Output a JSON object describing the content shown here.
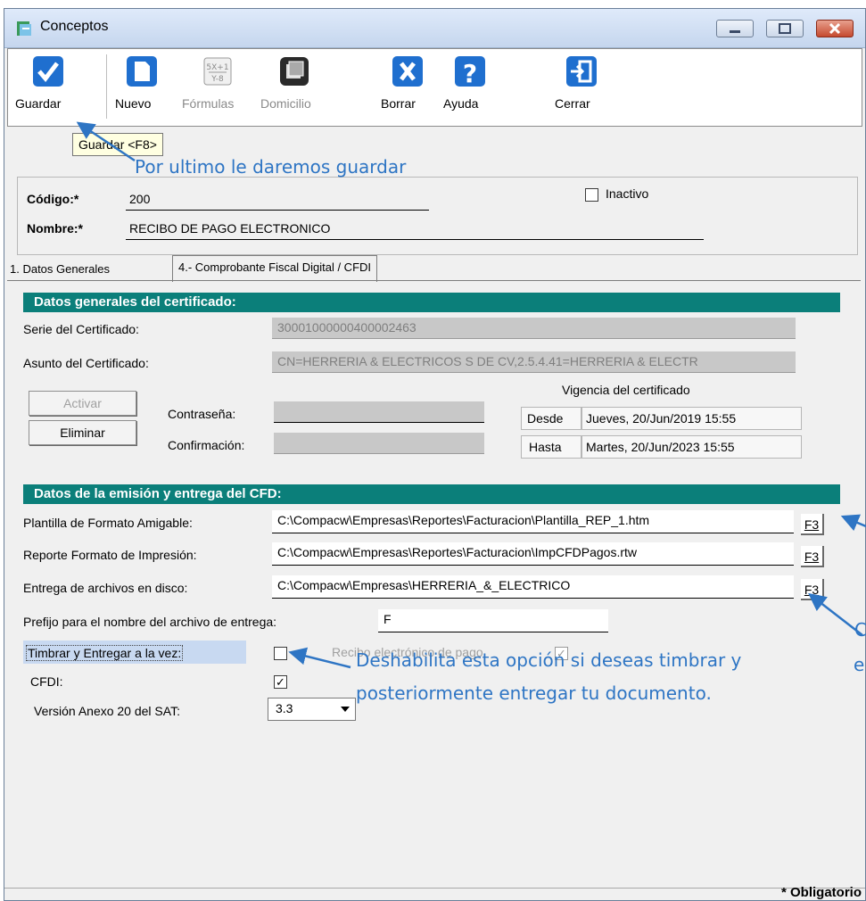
{
  "window": {
    "title": "Conceptos"
  },
  "toolbar": {
    "buttons": [
      {
        "label": "Guardar",
        "icon": "checkmark-icon"
      },
      {
        "label": "Nuevo",
        "icon": "new-document-icon"
      },
      {
        "label": "Fórmulas",
        "icon": "formula-icon"
      },
      {
        "label": "Domicilio",
        "icon": "address-icon"
      },
      {
        "label": "Borrar",
        "icon": "delete-icon"
      },
      {
        "label": "Ayuda",
        "icon": "help-icon"
      },
      {
        "label": "Cerrar",
        "icon": "exit-icon"
      }
    ]
  },
  "tooltip": "Guardar <F8>",
  "annotations": {
    "save_note": "Por ultimo le daremos guardar",
    "timbrar_note_line1": "Deshabilita esta opción si deseas timbrar y",
    "timbrar_note_line2": "posteriormente entregar tu documento.",
    "cut_text_1": "C",
    "cut_text_2": "e"
  },
  "header": {
    "codigo_label": "Código:*",
    "codigo_value": "200",
    "nombre_label": "Nombre:*",
    "nombre_value": "RECIBO DE PAGO ELECTRONICO",
    "inactivo_label": "Inactivo"
  },
  "tabs": [
    {
      "label": "1. Datos Generales"
    },
    {
      "label": "4.- Comprobante Fiscal Digital / CFDI"
    }
  ],
  "cert": {
    "section_title": "Datos generales del certificado:",
    "serie_label": "Serie del Certificado:",
    "serie_value": "30001000000400002463",
    "asunto_label": "Asunto del Certificado:",
    "asunto_value": "CN=HERRERIA & ELECTRICOS S DE CV,2.5.4.41=HERRERIA & ELECTR",
    "activar_label": "Activar",
    "eliminar_label": "Eliminar",
    "contrasena_label": "Contraseña:",
    "confirmacion_label": "Confirmación:",
    "vigencia_label": "Vigencia del certificado",
    "desde_label": "Desde",
    "desde_value": "Jueves, 20/Jun/2019 15:55",
    "hasta_label": "Hasta",
    "hasta_value": "Martes, 20/Jun/2023 15:55"
  },
  "cfd": {
    "section_title": "Datos de la emisión y entrega del CFD:",
    "plantilla_label": "Plantilla de Formato Amigable:",
    "plantilla_value": "C:\\Compacw\\Empresas\\Reportes\\Facturacion\\Plantilla_REP_1.htm",
    "reporte_label": "Reporte Formato de Impresión:",
    "reporte_value": "C:\\Compacw\\Empresas\\Reportes\\Facturacion\\ImpCFDPagos.rtw",
    "entrega_label": "Entrega de archivos en disco:",
    "entrega_value": "C:\\Compacw\\Empresas\\HERRERIA_&_ELECTRICO",
    "f3_label": "F3",
    "prefijo_label": "Prefijo para el nombre del archivo de entrega:",
    "prefijo_value": "F",
    "timbrar_label": "Timbrar y Entregar a la vez:",
    "recibo_label": "Recibo electrónico de pago",
    "cfdi_label": "CFDI:",
    "version_label": "Versión Anexo 20 del SAT:",
    "version_value": "3.3"
  },
  "status": {
    "obligatorio": "* Obligatorio"
  },
  "colors": {
    "section": "#0b7f7a",
    "annotation": "#2e75c4",
    "tooltip": "#ffffe1"
  }
}
